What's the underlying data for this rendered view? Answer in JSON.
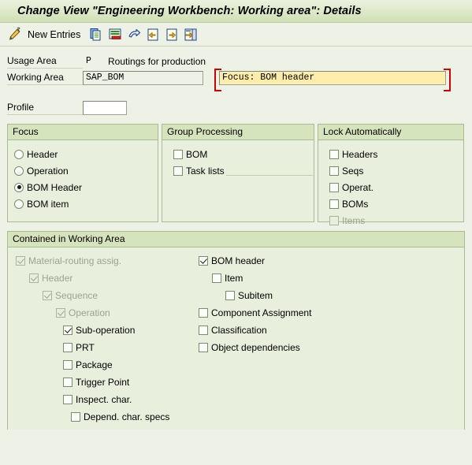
{
  "window": {
    "title": "Change View \"Engineering Workbench: Working area\": Details"
  },
  "toolbar": {
    "edit_icon": "pencil-icon",
    "new_entries_label": "New Entries",
    "icons": [
      {
        "name": "copy-icon",
        "title": "Copy As..."
      },
      {
        "name": "delete-row-icon",
        "title": "Delete"
      },
      {
        "name": "undo-icon",
        "title": "Undo Change"
      },
      {
        "name": "previous-entry-icon",
        "title": "Previous Entry"
      },
      {
        "name": "next-entry-icon",
        "title": "Next Entry"
      },
      {
        "name": "details-icon",
        "title": "Details"
      }
    ]
  },
  "form": {
    "usage_area": {
      "label": "Usage Area",
      "key": "P",
      "text": "Routings for production"
    },
    "working_area": {
      "label": "Working Area",
      "value": "SAP_BOM",
      "focus_value": "Focus: BOM header"
    },
    "profile": {
      "label": "Profile",
      "value": ""
    }
  },
  "groups": {
    "focus": {
      "title": "Focus",
      "options": [
        {
          "label": "Header",
          "selected": false
        },
        {
          "label": "Operation",
          "selected": false
        },
        {
          "label": "BOM Header",
          "selected": true
        },
        {
          "label": "BOM item",
          "selected": false
        }
      ]
    },
    "group_processing": {
      "title": "Group Processing",
      "options": [
        {
          "label": "BOM",
          "checked": false,
          "disabled": false
        },
        {
          "label": "Task lists",
          "checked": false,
          "disabled": false
        }
      ]
    },
    "lock_automatically": {
      "title": "Lock Automatically",
      "options": [
        {
          "label": "Headers",
          "checked": false,
          "disabled": false
        },
        {
          "label": "Seqs",
          "checked": false,
          "disabled": false
        },
        {
          "label": "Operat.",
          "checked": false,
          "disabled": false
        },
        {
          "label": "BOMs",
          "checked": false,
          "disabled": false
        },
        {
          "label": "Items",
          "checked": false,
          "disabled": true
        }
      ]
    }
  },
  "contained": {
    "title": "Contained in Working Area",
    "left_column": [
      {
        "label": "Material-routing assig.",
        "checked": true,
        "disabled": true,
        "indent": 0
      },
      {
        "label": "Header",
        "checked": true,
        "disabled": true,
        "indent": 1
      },
      {
        "label": "Sequence",
        "checked": true,
        "disabled": true,
        "indent": 2
      },
      {
        "label": "Operation",
        "checked": true,
        "disabled": true,
        "indent": 3
      },
      {
        "label": "Sub-operation",
        "checked": true,
        "disabled": false,
        "indent": 4
      },
      {
        "label": "PRT",
        "checked": false,
        "disabled": false,
        "indent": 4
      },
      {
        "label": "Package",
        "checked": false,
        "disabled": false,
        "indent": 4
      },
      {
        "label": "Trigger Point",
        "checked": false,
        "disabled": false,
        "indent": 4
      },
      {
        "label": "Inspect. char.",
        "checked": false,
        "disabled": false,
        "indent": 4
      },
      {
        "label": "Depend. char. specs",
        "checked": false,
        "disabled": false,
        "indent": 5
      }
    ],
    "right_column": [
      {
        "label": "BOM header",
        "checked": true,
        "disabled": false,
        "indent": 0
      },
      {
        "label": "Item",
        "checked": false,
        "disabled": false,
        "indent": 1
      },
      {
        "label": "Subitem",
        "checked": false,
        "disabled": false,
        "indent": 2
      },
      {
        "label": "Component Assignment",
        "checked": false,
        "disabled": false,
        "indent": 0
      },
      {
        "label": "Classification",
        "checked": false,
        "disabled": false,
        "indent": 0
      },
      {
        "label": "Object dependencies",
        "checked": false,
        "disabled": false,
        "indent": 0
      }
    ]
  },
  "colors": {
    "background": "#eef2e6",
    "title_gradient_top": "#eaf1de",
    "title_gradient_bottom": "#cfdfb5",
    "group_header": "#d6e4bd",
    "group_border": "#aabb92",
    "focus_field": "#ffeeab",
    "focus_bracket": "#cc0000"
  }
}
